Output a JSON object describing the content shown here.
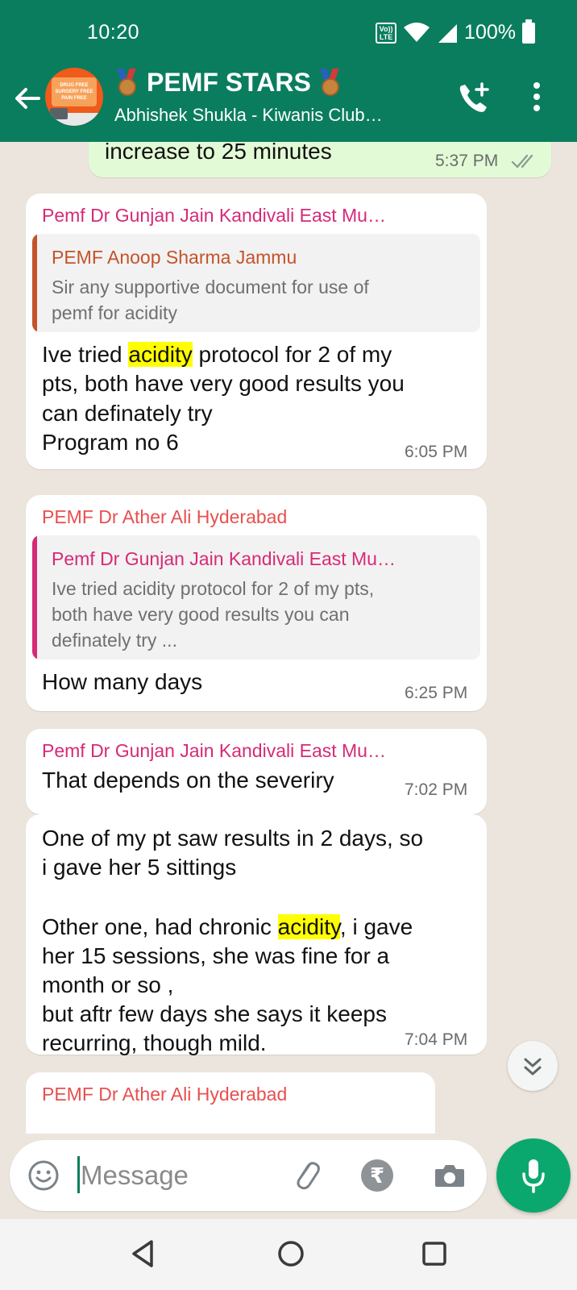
{
  "status_bar": {
    "time": "10:20",
    "lte_label": "Vo)) LTE",
    "battery": "100%"
  },
  "header": {
    "title": "PEMF STARS",
    "subtitle": "Abhishek Shukla - Kiwanis Club…",
    "avatar_text": "DRUG FREE SURGERY FREE PAIN FREE",
    "accent_color": "#0a7d5e"
  },
  "messages": [
    {
      "type": "outgoing",
      "text": "increase to 25 minutes",
      "time": "5:37 PM",
      "status_icon": "double-check-icon"
    },
    {
      "type": "incoming",
      "sender": "Pemf Dr Gunjan Jain Kandivali East Mu…",
      "sender_color": "#d62a78",
      "quote": {
        "sender": "PEMF Anoop Sharma Jammu",
        "sender_color": "#c4532a",
        "text_lines": [
          "Sir any supportive document for use of",
          "pemf for acidity"
        ]
      },
      "text_lines": {
        "l1_pre": "Ive tried ",
        "l1_hl": "acidity",
        "l1_post": " protocol for 2 of my",
        "l2": "pts, both have very good results you",
        "l3": "can definately try",
        "l4": "Program no 6"
      },
      "time": "6:05 PM"
    },
    {
      "type": "incoming",
      "sender": "PEMF Dr Ather Ali Hyderabad",
      "sender_color": "#e84f4f",
      "quote": {
        "sender": "Pemf Dr Gunjan Jain Kandivali East Mu…",
        "sender_color": "#d62a78",
        "text_lines": [
          "Ive tried acidity protocol for 2 of my pts,",
          "both have very good results you can",
          "definately try ..."
        ]
      },
      "text": "How many days",
      "time": "6:25 PM"
    },
    {
      "type": "incoming",
      "sender": "Pemf Dr Gunjan Jain Kandivali East Mu…",
      "sender_color": "#d62a78",
      "text": "That depends on the severiry",
      "time": "7:02 PM"
    },
    {
      "type": "incoming",
      "text_lines": {
        "l1": "One of my pt saw results in 2 days, so",
        "l2": "i gave her 5 sittings",
        "l3_pre": "Other one, had chronic ",
        "l3_hl": "acidity",
        "l3_post": ", i gave",
        "l4": "her 15 sessions, she was fine for a",
        "l5": "month or so ,",
        "l6": "but aftr few days she says it keeps",
        "l7": "recurring, though mild."
      },
      "time": "7:04 PM"
    },
    {
      "type": "incoming",
      "sender": "PEMF Dr Ather Ali Hyderabad",
      "sender_color": "#e84f4f"
    }
  ],
  "composer": {
    "placeholder": "Message",
    "rupee_symbol": "₹"
  },
  "highlight_color": "#ffff00"
}
